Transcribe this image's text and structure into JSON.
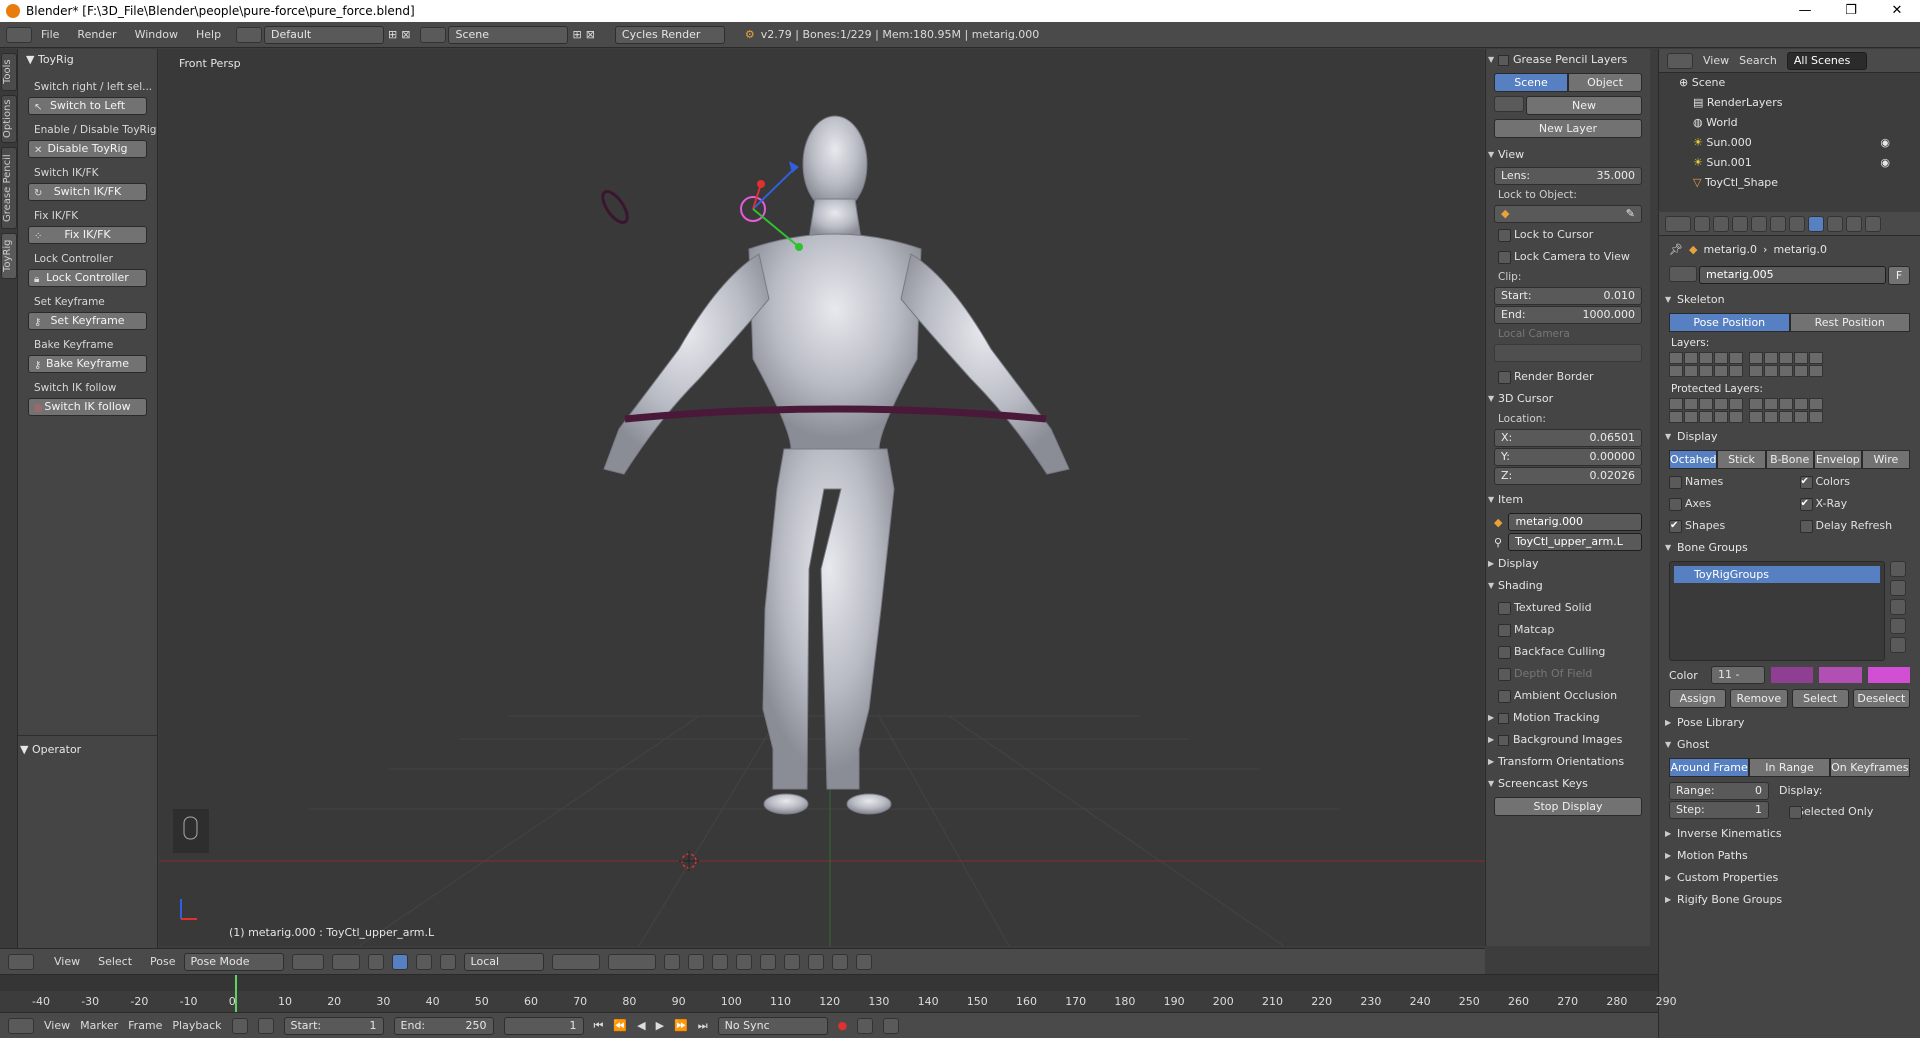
{
  "window": {
    "title": "Blender* [F:\\3D_File\\Blender\\people\\pure-force\\pure_force.blend]",
    "controls": [
      "—",
      "❐",
      "✕"
    ]
  },
  "menubar": {
    "menus": [
      "File",
      "Render",
      "Window",
      "Help"
    ],
    "screen_layout": "Default",
    "scene": "Scene",
    "render_engine": "Cycles Render",
    "info": "v2.79 | Bones:1/229 | Mem:180.95M | metarig.000"
  },
  "side_tabs": [
    "Tools",
    "Options",
    "Grease Pencil",
    "ToyRig"
  ],
  "toolshelf": {
    "panel_title": "ToyRig",
    "rows": [
      {
        "label": "Switch right / left sel...",
        "button": "Switch to Left"
      },
      {
        "label": "Enable / Disable ToyRig",
        "button": "Disable ToyRig"
      },
      {
        "label": "Switch IK/FK",
        "button": "Switch IK/FK"
      },
      {
        "label": "Fix IK/FK",
        "button": "Fix IK/FK"
      },
      {
        "label": "Lock Controller",
        "button": "Lock Controller"
      },
      {
        "label": "Set Keyframe",
        "button": "Set Keyframe"
      },
      {
        "label": "Bake Keyframe",
        "button": "Bake Keyframe"
      },
      {
        "label": "Switch IK follow",
        "button": "Switch IK follow"
      }
    ],
    "operator_title": "Operator"
  },
  "viewport": {
    "view_label": "Front Persp",
    "status": "(1) metarig.000 : ToyCtl_upper_arm.L",
    "header": {
      "menus": [
        "View",
        "Select",
        "Pose"
      ],
      "mode": "Pose Mode",
      "orientation": "Local"
    }
  },
  "nprops": {
    "grease_pencil": {
      "title": "Grease Pencil Layers",
      "tab_scene": "Scene",
      "tab_object": "Object",
      "new": "New",
      "new_layer": "New Layer"
    },
    "view": {
      "title": "View",
      "lens_label": "Lens:",
      "lens_value": "35.000",
      "lock_object_label": "Lock to Object:",
      "lock_cursor": "Lock to Cursor",
      "lock_camera": "Lock Camera to View",
      "clip_label": "Clip:",
      "start_label": "Start:",
      "start_value": "0.010",
      "end_label": "End:",
      "end_value": "1000.000",
      "local_camera": "Local Camera",
      "render_border": "Render Border"
    },
    "cursor": {
      "title": "3D Cursor",
      "location_label": "Location:",
      "x_label": "X:",
      "x": "0.06501",
      "y_label": "Y:",
      "y": "0.00000",
      "z_label": "Z:",
      "z": "0.02026"
    },
    "item": {
      "title": "Item",
      "object": "metarig.000",
      "bone": "ToyCtl_upper_arm.L"
    },
    "display_title": "Display",
    "shading": {
      "title": "Shading",
      "textured_solid": "Textured Solid",
      "matcap": "Matcap",
      "backface": "Backface Culling",
      "dof": "Depth Of Field",
      "ao": "Ambient Occlusion"
    },
    "motion_tracking": "Motion Tracking",
    "background_images": "Background Images",
    "transform_orientations": "Transform Orientations",
    "screencast": {
      "title": "Screencast Keys",
      "button": "Stop Display"
    }
  },
  "outliner": {
    "header": {
      "view": "View",
      "search": "Search",
      "filter": "All Scenes"
    },
    "items": [
      "Scene",
      "RenderLayers",
      "World",
      "Sun.000",
      "Sun.001",
      "ToyCtl_Shape"
    ]
  },
  "properties": {
    "breadcrumb": {
      "a": "metarig.0",
      "b": "metarig.0"
    },
    "armature_name": "metarig.005",
    "fake_user": "F",
    "skeleton": {
      "title": "Skeleton",
      "pose_position": "Pose Position",
      "rest_position": "Rest Position",
      "layers_label": "Layers:",
      "protected_label": "Protected Layers:"
    },
    "display": {
      "title": "Display",
      "modes": [
        "Octahed",
        "Stick",
        "B-Bone",
        "Envelop",
        "Wire"
      ],
      "names": "Names",
      "colors": "Colors",
      "axes": "Axes",
      "xray": "X-Ray",
      "shapes": "Shapes",
      "delay": "Delay Refresh"
    },
    "bone_groups": {
      "title": "Bone Groups",
      "item": "ToyRigGroups",
      "color_label": "Color",
      "color_value": "11 -",
      "assign": "Assign",
      "remove": "Remove",
      "select": "Select",
      "deselect": "Deselect",
      "swatches": [
        "#8e3f92",
        "#b24fb5",
        "#d04fd2"
      ]
    },
    "pose_library": "Pose Library",
    "ghost": {
      "title": "Ghost",
      "modes": [
        "Around Frame",
        "In Range",
        "On Keyframes"
      ],
      "range_label": "Range:",
      "range_value": "0",
      "step_label": "Step:",
      "step_value": "1",
      "display_label": "Display:",
      "selected_only": "Selected Only"
    },
    "collapsed": [
      "Inverse Kinematics",
      "Motion Paths",
      "Custom Properties",
      "Rigify Bone Groups"
    ]
  },
  "timeline": {
    "ticks": [
      "-40",
      "-30",
      "-20",
      "-10",
      "0",
      "10",
      "20",
      "30",
      "40",
      "50",
      "60",
      "70",
      "80",
      "90",
      "100",
      "110",
      "120",
      "130",
      "140",
      "150",
      "160",
      "170",
      "180",
      "190",
      "200",
      "210",
      "220",
      "230",
      "240",
      "250",
      "260",
      "270",
      "280",
      "290"
    ],
    "menus": [
      "View",
      "Marker",
      "Frame",
      "Playback"
    ],
    "start_label": "Start:",
    "start_value": "1",
    "end_label": "End:",
    "end_value": "250",
    "current_frame": "1",
    "sync": "No Sync"
  },
  "colors": {
    "accent": "#5680c2",
    "viewport_bg": "#393939",
    "panel_bg": "#454545",
    "skin": "#c9cbd3"
  }
}
